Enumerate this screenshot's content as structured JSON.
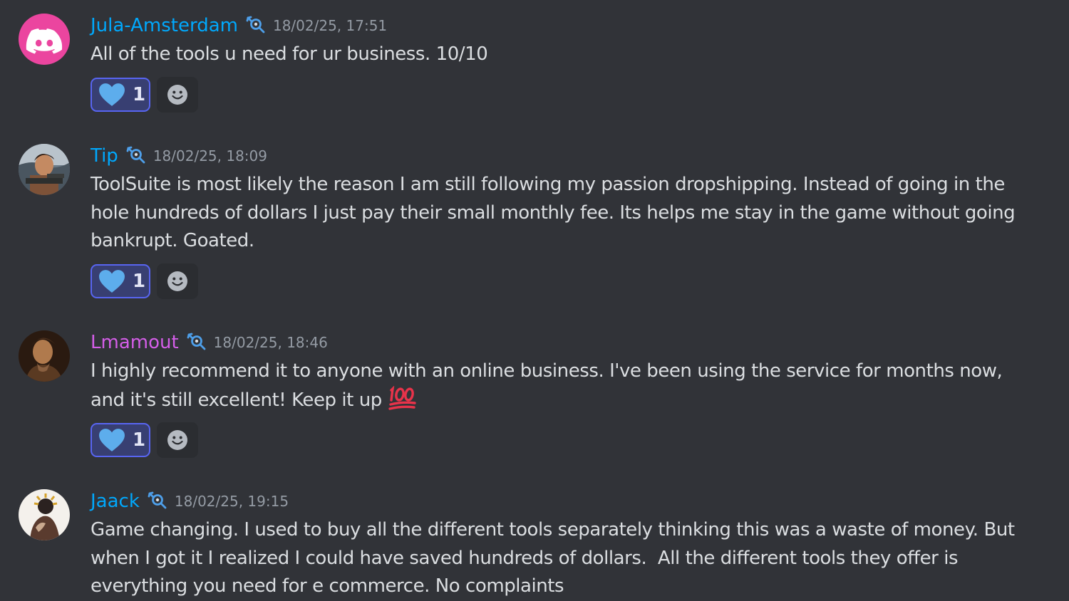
{
  "colors": {
    "background": "#313338",
    "text": "#dbdee1",
    "timestamp": "#949ba4",
    "username_blue": "#00a8fc",
    "username_pink": "#d45ee8",
    "reaction_border": "#5865f2",
    "reaction_bg": "#383f72"
  },
  "messages": [
    {
      "username": "Jula-Amsterdam",
      "username_color": "#00a8fc",
      "role_icon": "wrench-magnifier-icon",
      "timestamp": "18/02/25, 17:51",
      "text": "All of the tools u need for ur business. 10/10",
      "reaction": {
        "emoji": "blue-heart-icon",
        "count": "1"
      },
      "avatar": "discord-logo-avatar"
    },
    {
      "username": "Tip",
      "username_color": "#00a8fc",
      "role_icon": "wrench-magnifier-icon",
      "timestamp": "18/02/25, 18:09",
      "text": "ToolSuite is most likely the reason I am still following my passion dropshipping. Instead of going in the hole hundreds of dollars I just pay their small monthly fee. Its helps me stay in the game without going bankrupt. Goated.",
      "reaction": {
        "emoji": "blue-heart-icon",
        "count": "1"
      },
      "avatar": "photo-avatar"
    },
    {
      "username": "Lmamout",
      "username_color": "#d45ee8",
      "role_icon": "wrench-magnifier-icon",
      "timestamp": "18/02/25, 18:46",
      "text": "I highly recommend it to anyone with an online business. I've been using the service for months now, and it's still excellent! Keep it up ",
      "text_emoji": "hundred-points-icon",
      "reaction": {
        "emoji": "blue-heart-icon",
        "count": "1"
      },
      "avatar": "painting-avatar"
    },
    {
      "username": "Jaack",
      "username_color": "#00a8fc",
      "role_icon": "wrench-magnifier-icon",
      "timestamp": "18/02/25, 19:15",
      "text": "Game changing. I used to buy all the different tools separately thinking this was a waste of money. But when I got it I realized I could have saved hundreds of dollars.  All the different tools they offer is everything you need for e commerce. No complaints",
      "avatar": "illustration-avatar"
    }
  ]
}
